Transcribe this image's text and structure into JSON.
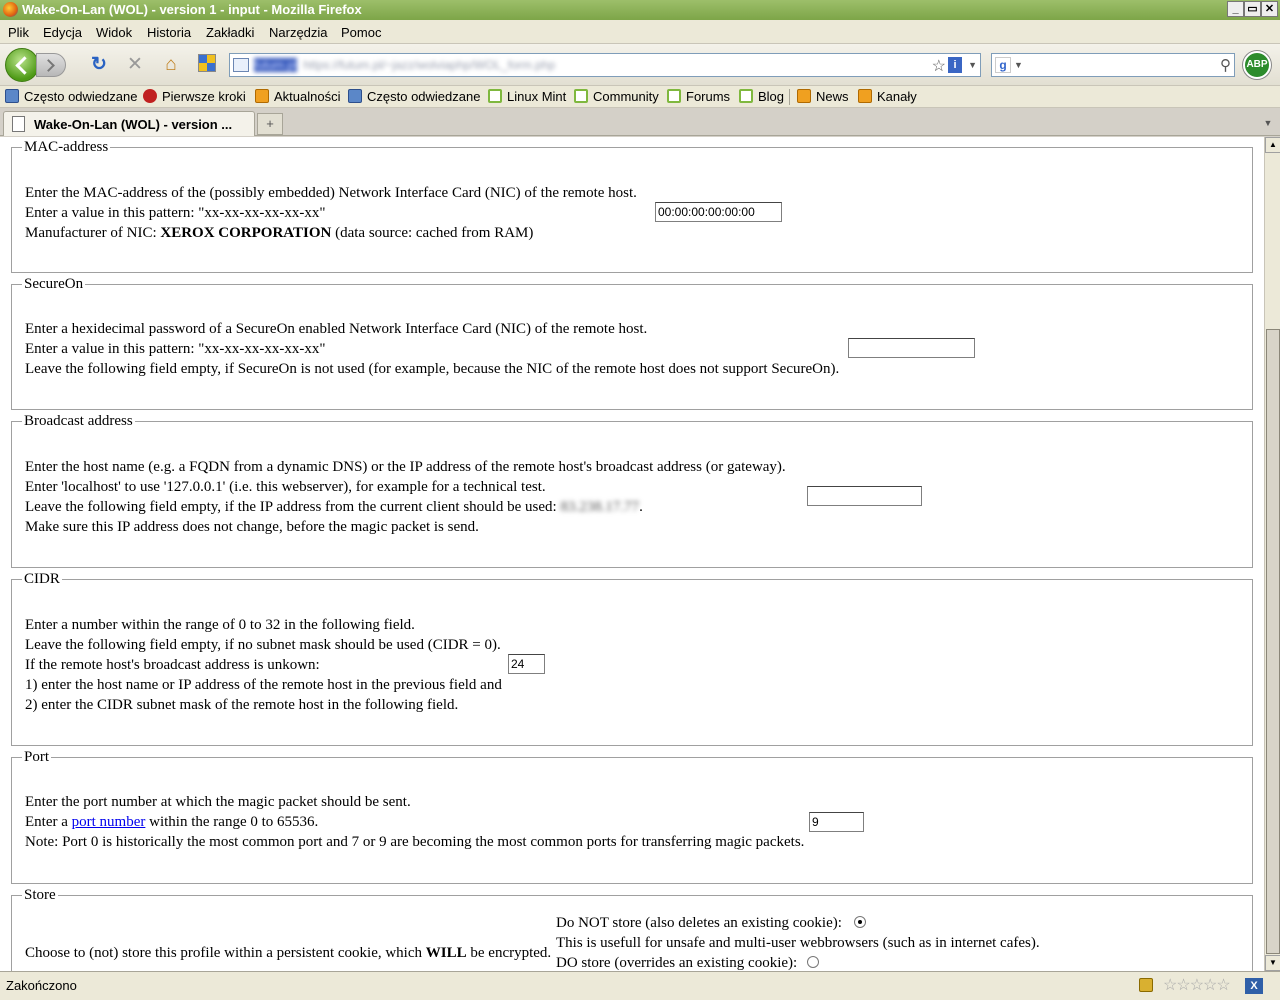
{
  "window": {
    "title": "Wake-On-Lan (WOL) - version 1 - input - Mozilla Firefox",
    "minimize": "_",
    "maximize": "▭",
    "close": "✕"
  },
  "menu": [
    "Plik",
    "Edycja",
    "Widok",
    "Historia",
    "Zakładki",
    "Narzędzia",
    "Pomoc"
  ],
  "navbar": {
    "url_host": "futum.pl",
    "url_path": "https://futum.pl/~jazz/wolviaphp/WOL_form.php",
    "search_value": "",
    "abp_label": "ABP"
  },
  "bookmarks": [
    {
      "label": "Często odwiedzane",
      "icon": "folder-icon"
    },
    {
      "label": "Pierwsze kroki",
      "icon": "firefox-icon"
    },
    {
      "label": "Aktualności",
      "icon": "rss-icon"
    },
    {
      "label": "Często odwiedzane",
      "icon": "folder-icon"
    },
    {
      "label": "Linux Mint",
      "icon": "mint-icon"
    },
    {
      "label": "Community",
      "icon": "mint-icon"
    },
    {
      "label": "Forums",
      "icon": "mint-icon"
    },
    {
      "label": "Blog",
      "icon": "mint-icon"
    },
    {
      "label": "News",
      "icon": "rss-icon"
    },
    {
      "label": "Kanały",
      "icon": "rss-icon"
    }
  ],
  "tab": {
    "label": "Wake-On-Lan (WOL) - version ...",
    "new_tab": "+"
  },
  "sections": {
    "mac": {
      "legend": "MAC-address",
      "line1": "Enter the MAC-address of the (possibly embedded) Network Interface Card (NIC) of the remote host.",
      "line2": "Enter a value in this pattern: \"xx-xx-xx-xx-xx-xx\"",
      "line3_prefix": "Manufacturer of NIC: ",
      "line3_bold": "XEROX CORPORATION",
      "line3_suffix": " (data source: cached from RAM)",
      "input_value": "00:00:00:00:00:00"
    },
    "secureon": {
      "legend": "SecureOn",
      "line1": "Enter a hexidecimal password of a SecureOn enabled Network Interface Card (NIC) of the remote host.",
      "line2": "Enter a value in this pattern: \"xx-xx-xx-xx-xx-xx\"",
      "line3": "Leave the following field empty, if SecureOn is not used (for example, because the NIC of the remote host does not support SecureOn).",
      "input_value": ""
    },
    "broadcast": {
      "legend": "Broadcast address",
      "line1": "Enter the host name (e.g. a FQDN from a dynamic DNS) or the IP address of the remote host's broadcast address (or gateway).",
      "line2": "Enter 'localhost' to use '127.0.0.1' (i.e. this webserver), for example for a technical test.",
      "line3_prefix": "Leave the following field empty, if the IP address from the current client should be used: ",
      "line3_ip": "83.238.17.77",
      "line3_suffix": ".",
      "line4": "Make sure this IP address does not change, before the magic packet is send.",
      "input_value": ""
    },
    "cidr": {
      "legend": "CIDR",
      "line1": "Enter a number within the range of 0 to 32 in the following field.",
      "line2": "Leave the following field empty, if no subnet mask should be used (CIDR = 0).",
      "line3": "If the remote host's broadcast address is unkown:",
      "line4": "1) enter the host name or IP address of the remote host in the previous field and",
      "line5": "2) enter the CIDR subnet mask of the remote host in the following field.",
      "input_value": "24"
    },
    "port": {
      "legend": "Port",
      "line1": "Enter the port number at which the magic packet should be sent.",
      "line2_prefix": "Enter a ",
      "line2_link": "port number",
      "line2_suffix": " within the range 0 to 65536.",
      "line3": "Note: Port 0 is historically the most common port and 7 or 9 are becoming the most common ports for transferring magic packets.",
      "input_value": "9"
    },
    "store": {
      "legend": "Store",
      "left_prefix": "Choose to (not) store this profile within a persistent cookie, which ",
      "left_bold": "WILL",
      "left_suffix": " be encrypted.",
      "opt1": "Do NOT store (also deletes an existing cookie):",
      "opt1_note": "This is usefull for unsafe and multi-user webbrowsers (such as in internet cafes).",
      "opt2": "DO store (overrides an existing cookie):",
      "selected": "opt1"
    }
  },
  "status": {
    "text": "Zakończono",
    "stars": "☆☆☆☆☆",
    "xmarks": "X"
  }
}
